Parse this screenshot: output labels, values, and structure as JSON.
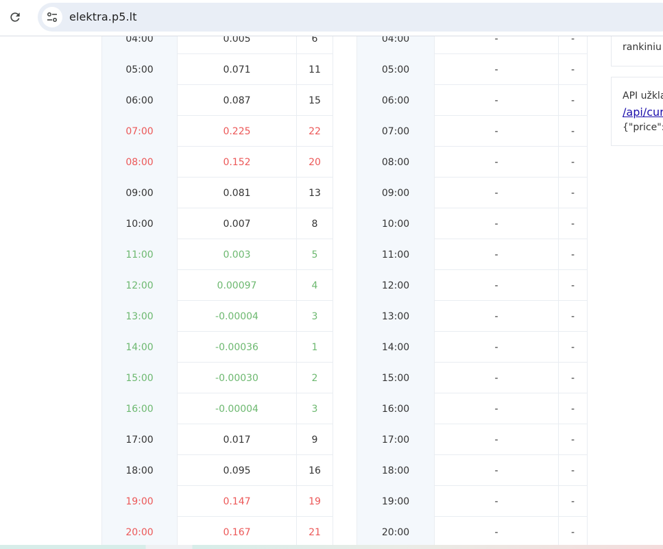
{
  "browser": {
    "url": "elektra.p5.lt",
    "reload_icon": "reload-icon",
    "site_info_icon": "tune-icon"
  },
  "colors": {
    "expensive": "#ec5757",
    "cheap": "#6cb86f",
    "normal": "#333333"
  },
  "today_rows": [
    {
      "time": "04:00",
      "price": "0.005",
      "rank": "6",
      "level": "normal"
    },
    {
      "time": "05:00",
      "price": "0.071",
      "rank": "11",
      "level": "normal"
    },
    {
      "time": "06:00",
      "price": "0.087",
      "rank": "15",
      "level": "normal"
    },
    {
      "time": "07:00",
      "price": "0.225",
      "rank": "22",
      "level": "expensive"
    },
    {
      "time": "08:00",
      "price": "0.152",
      "rank": "20",
      "level": "expensive"
    },
    {
      "time": "09:00",
      "price": "0.081",
      "rank": "13",
      "level": "normal"
    },
    {
      "time": "10:00",
      "price": "0.007",
      "rank": "8",
      "level": "normal"
    },
    {
      "time": "11:00",
      "price": "0.003",
      "rank": "5",
      "level": "cheap"
    },
    {
      "time": "12:00",
      "price": "0.00097",
      "rank": "4",
      "level": "cheap"
    },
    {
      "time": "13:00",
      "price": "-0.00004",
      "rank": "3",
      "level": "cheap"
    },
    {
      "time": "14:00",
      "price": "-0.00036",
      "rank": "1",
      "level": "cheap"
    },
    {
      "time": "15:00",
      "price": "-0.00030",
      "rank": "2",
      "level": "cheap"
    },
    {
      "time": "16:00",
      "price": "-0.00004",
      "rank": "3",
      "level": "cheap"
    },
    {
      "time": "17:00",
      "price": "0.017",
      "rank": "9",
      "level": "normal"
    },
    {
      "time": "18:00",
      "price": "0.095",
      "rank": "16",
      "level": "normal"
    },
    {
      "time": "19:00",
      "price": "0.147",
      "rank": "19",
      "level": "expensive"
    },
    {
      "time": "20:00",
      "price": "0.167",
      "rank": "21",
      "level": "expensive"
    }
  ],
  "tomorrow_rows": [
    {
      "time": "04:00",
      "price": "-",
      "rank": "-"
    },
    {
      "time": "05:00",
      "price": "-",
      "rank": "-"
    },
    {
      "time": "06:00",
      "price": "-",
      "rank": "-"
    },
    {
      "time": "07:00",
      "price": "-",
      "rank": "-"
    },
    {
      "time": "08:00",
      "price": "-",
      "rank": "-"
    },
    {
      "time": "09:00",
      "price": "-",
      "rank": "-"
    },
    {
      "time": "10:00",
      "price": "-",
      "rank": "-"
    },
    {
      "time": "11:00",
      "price": "-",
      "rank": "-"
    },
    {
      "time": "12:00",
      "price": "-",
      "rank": "-"
    },
    {
      "time": "13:00",
      "price": "-",
      "rank": "-"
    },
    {
      "time": "14:00",
      "price": "-",
      "rank": "-"
    },
    {
      "time": "15:00",
      "price": "-",
      "rank": "-"
    },
    {
      "time": "16:00",
      "price": "-",
      "rank": "-"
    },
    {
      "time": "17:00",
      "price": "-",
      "rank": "-"
    },
    {
      "time": "18:00",
      "price": "-",
      "rank": "-"
    },
    {
      "time": "19:00",
      "price": "-",
      "rank": "-"
    },
    {
      "time": "20:00",
      "price": "-",
      "rank": "-"
    }
  ],
  "sidebar": {
    "card1_text": "rankiniu",
    "card2_line1": "API užklа",
    "card2_link": "/api/cur",
    "card2_line3": "{\"price\":\""
  }
}
